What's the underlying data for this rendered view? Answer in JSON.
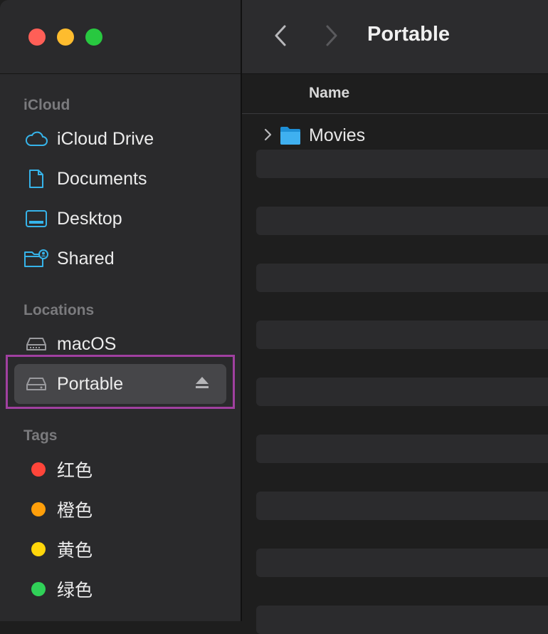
{
  "window": {
    "title": "Portable"
  },
  "sidebar": {
    "sections": [
      {
        "header": "iCloud"
      },
      {
        "header": "Locations"
      },
      {
        "header": "Tags"
      }
    ],
    "icloud_items": [
      {
        "label": "iCloud Drive",
        "icon": "cloud-icon"
      },
      {
        "label": "Documents",
        "icon": "document-icon"
      },
      {
        "label": "Desktop",
        "icon": "desktop-icon"
      },
      {
        "label": "Shared",
        "icon": "shared-folder-icon"
      }
    ],
    "location_items": [
      {
        "label": "macOS",
        "icon": "internal-drive-icon"
      },
      {
        "label": "Portable",
        "icon": "external-drive-icon",
        "selected": true
      }
    ],
    "tag_items": [
      {
        "label": "红色",
        "color": "#ff453a"
      },
      {
        "label": "橙色",
        "color": "#ff9f0a"
      },
      {
        "label": "黄色",
        "color": "#ffd60a"
      },
      {
        "label": "绿色",
        "color": "#30d158"
      }
    ]
  },
  "list": {
    "column_name": "Name",
    "rows": [
      {
        "name": "Movies",
        "icon": "folder-icon"
      }
    ]
  },
  "colors": {
    "accent": "#36b3e9",
    "selection": "#464649",
    "highlight": "#a040a0"
  }
}
